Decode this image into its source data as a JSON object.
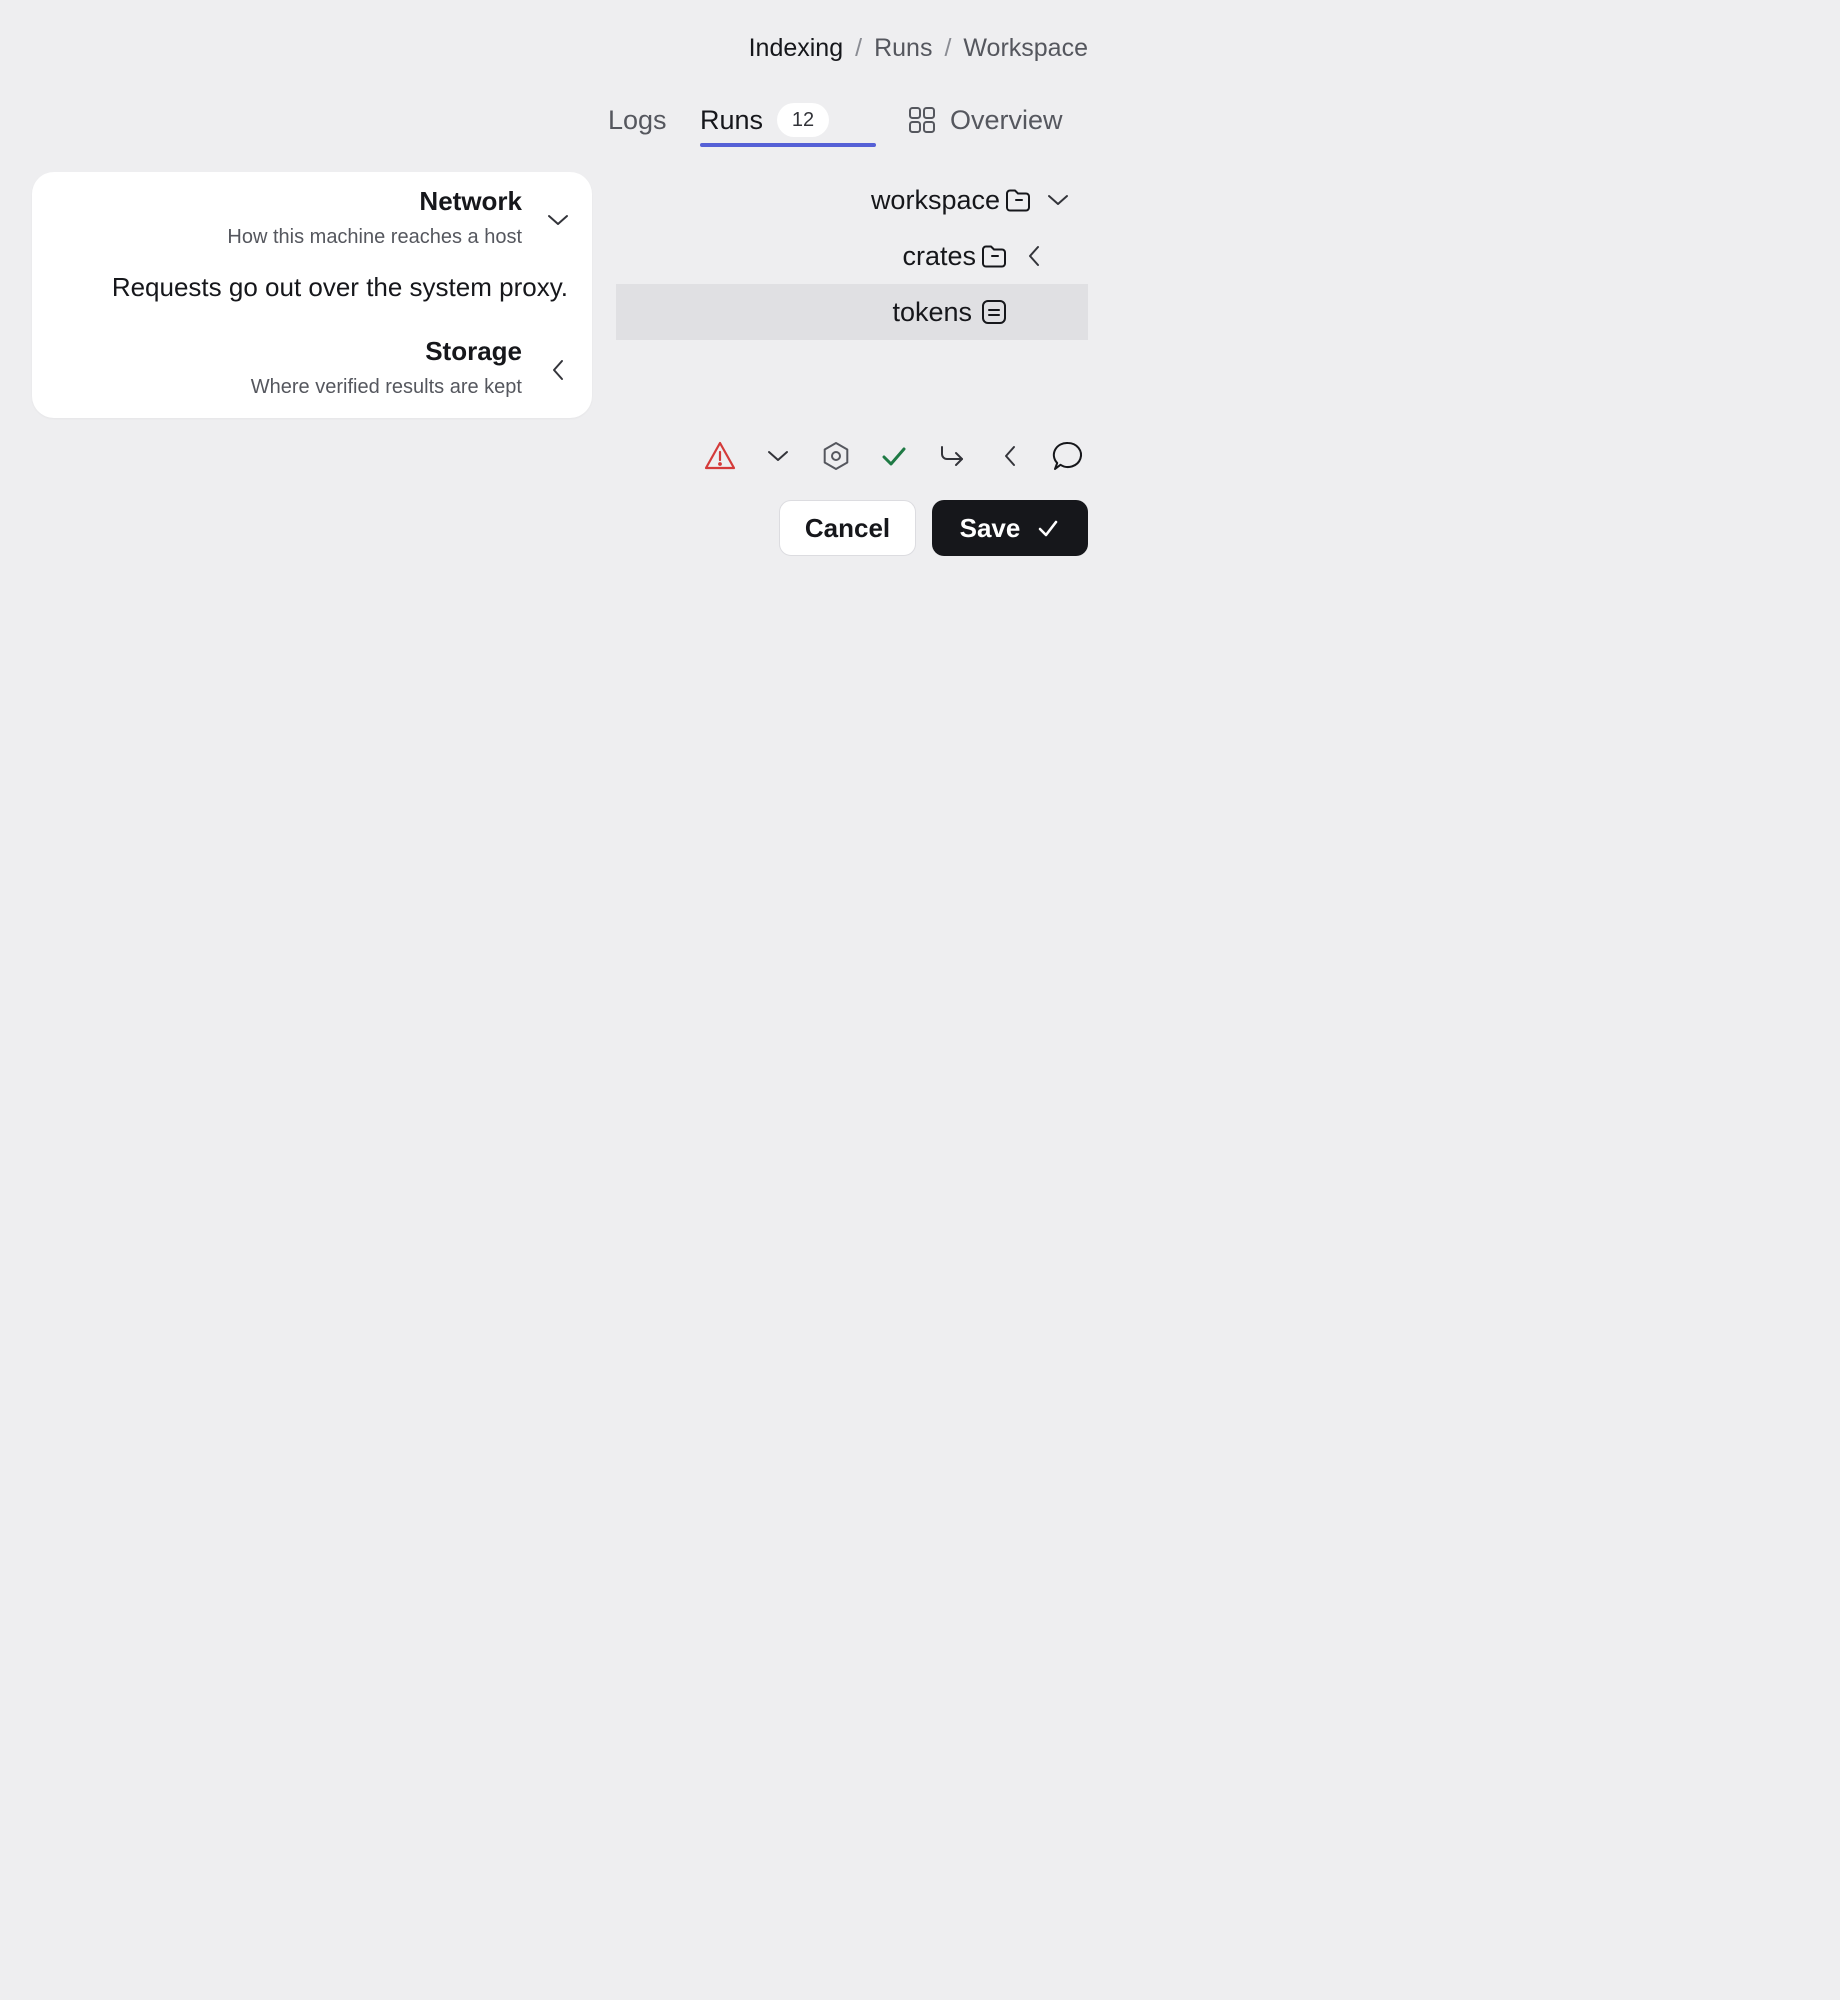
{
  "breadcrumb": {
    "items": [
      "Indexing",
      "Runs",
      "Workspace"
    ],
    "separator": "/"
  },
  "tabs": {
    "logs": {
      "label": "Logs"
    },
    "runs": {
      "label": "Runs",
      "count": "12"
    },
    "overview": {
      "label": "Overview",
      "icon": "grid-icon"
    },
    "active": "runs",
    "accent_color": "#5560d6"
  },
  "tree": {
    "items": [
      {
        "label": "workspace",
        "icon": "folder-icon",
        "state": "expanded"
      },
      {
        "label": "crates",
        "icon": "folder-icon",
        "state": "collapsed"
      },
      {
        "label": "tokens",
        "icon": "file-icon",
        "selected": true
      }
    ]
  },
  "settings": {
    "network": {
      "title": "Network",
      "subtitle": "How this machine reaches a host",
      "body": "Requests go out over the system proxy.",
      "expanded": true
    },
    "storage": {
      "title": "Storage",
      "subtitle": "Where verified results are kept",
      "expanded": false
    }
  },
  "toolbar": {
    "icons": [
      "warning-icon",
      "chevron-down-icon",
      "settings-icon",
      "check-icon",
      "redirect-icon",
      "chevron-left-icon",
      "comment-icon"
    ],
    "warning_color": "#d43a3a",
    "success_color": "#1f7a45"
  },
  "actions": {
    "cancel_label": "Cancel",
    "save_label": "Save"
  }
}
